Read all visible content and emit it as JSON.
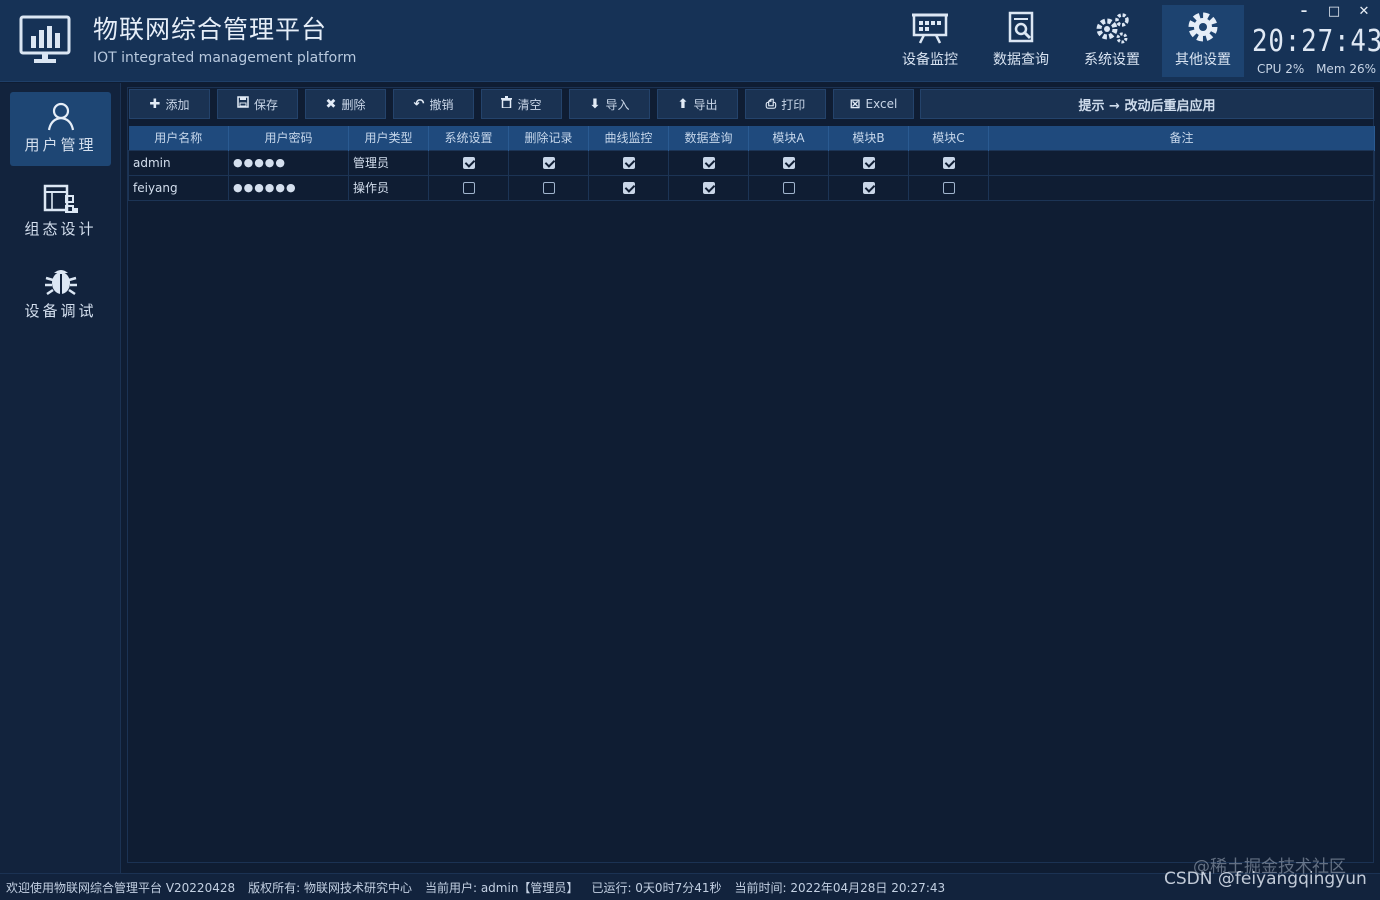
{
  "app": {
    "title": "物联网综合管理平台",
    "subtitle": "IOT integrated management platform"
  },
  "nav": [
    {
      "label": "设备监控",
      "icon": "monitor-board-icon"
    },
    {
      "label": "数据查询",
      "icon": "document-search-icon"
    },
    {
      "label": "系统设置",
      "icon": "gears-icon"
    },
    {
      "label": "其他设置",
      "icon": "gear-icon",
      "active": true
    }
  ],
  "clock": "20:27:43",
  "sysinfo": {
    "cpu": "CPU 2%",
    "mem": "Mem 26%"
  },
  "window_controls": {
    "minimize": "–",
    "maximize": "□",
    "close": "✕"
  },
  "sidebar": [
    {
      "label": "用户管理",
      "icon": "user-icon",
      "active": true
    },
    {
      "label": "组态设计",
      "icon": "flowchart-icon"
    },
    {
      "label": "设备调试",
      "icon": "bug-icon"
    }
  ],
  "toolbar": [
    {
      "label": "添加",
      "icon": "plus-icon",
      "glyph": "✚"
    },
    {
      "label": "保存",
      "icon": "save-icon",
      "glyph": "💾"
    },
    {
      "label": "删除",
      "icon": "delete-icon",
      "glyph": "✖"
    },
    {
      "label": "撤销",
      "icon": "undo-icon",
      "glyph": "↶"
    },
    {
      "label": "清空",
      "icon": "trash-icon",
      "glyph": "🗑"
    },
    {
      "label": "导入",
      "icon": "arrow-down-icon",
      "glyph": "⬇"
    },
    {
      "label": "导出",
      "icon": "arrow-up-icon",
      "glyph": "⬆"
    },
    {
      "label": "打印",
      "icon": "print-icon",
      "glyph": "⎙"
    },
    {
      "label": "Excel",
      "icon": "excel-icon",
      "glyph": "⊠"
    }
  ],
  "hint": "提示 → 改动后重启应用",
  "table": {
    "columns": [
      "用户名称",
      "用户密码",
      "用户类型",
      "系统设置",
      "删除记录",
      "曲线监控",
      "数据查询",
      "模块A",
      "模块B",
      "模块C",
      "备注"
    ],
    "rows": [
      {
        "name": "admin",
        "password": "●●●●●",
        "type": "管理员",
        "perms": [
          true,
          true,
          true,
          true,
          true,
          true,
          true
        ],
        "note": ""
      },
      {
        "name": "feiyang",
        "password": "●●●●●●",
        "type": "操作员",
        "perms": [
          false,
          false,
          true,
          true,
          false,
          true,
          false
        ],
        "note": ""
      }
    ]
  },
  "status": {
    "welcome": "欢迎使用物联网综合管理平台 V20220428",
    "copyright": "版权所有: 物联网技术研究中心",
    "user": "当前用户: admin【管理员】",
    "uptime": "已运行: 0天0时7分41秒",
    "time": "当前时间: 2022年04月28日 20:27:43"
  },
  "watermark": {
    "line1": "@稀土掘金技术社区",
    "line2": "CSDN @feiyangqingyun"
  },
  "colors": {
    "background": "#0f1d33",
    "titlebar": "#163256",
    "header": "#1f4a7d",
    "active": "#1e4674"
  }
}
